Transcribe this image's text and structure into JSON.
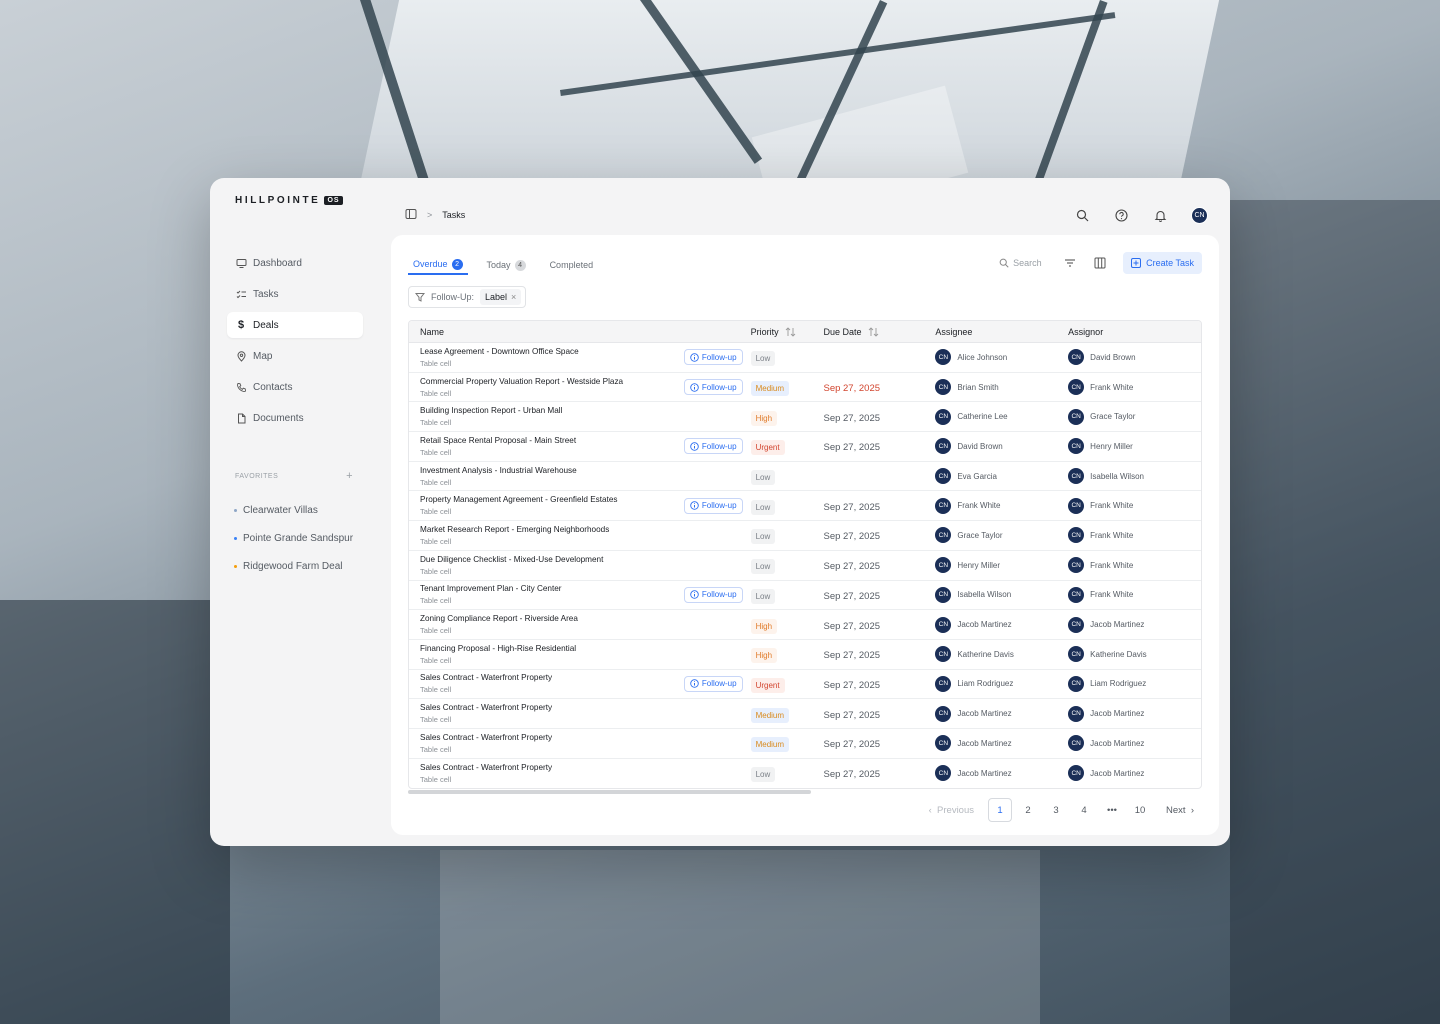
{
  "brand": {
    "name": "HILLPOINTE",
    "suffix": "OS"
  },
  "nav": [
    {
      "label": "Dashboard",
      "icon": "monitor-icon"
    },
    {
      "label": "Tasks",
      "icon": "checklist-icon"
    },
    {
      "label": "Deals",
      "icon": "dollar-icon",
      "active": true
    },
    {
      "label": "Map",
      "icon": "map-pin-icon"
    },
    {
      "label": "Contacts",
      "icon": "phone-icon"
    },
    {
      "label": "Documents",
      "icon": "file-icon"
    }
  ],
  "favorites": {
    "heading": "FAVORITES",
    "add": "+",
    "items": [
      {
        "label": "Clearwater Villas",
        "color": "#8ea6c6"
      },
      {
        "label": "Pointe Grande Sandspur",
        "color": "#3b82f6"
      },
      {
        "label": "Ridgewood Farm Deal",
        "color": "#f59e0b"
      }
    ]
  },
  "breadcrumb": {
    "separator": ">",
    "current": "Tasks"
  },
  "user": {
    "initials": "CN"
  },
  "tabs": [
    {
      "label": "Overdue",
      "count": "2",
      "active": true
    },
    {
      "label": "Today",
      "count": "4"
    },
    {
      "label": "Completed"
    }
  ],
  "search": {
    "placeholder": "Search"
  },
  "create_label": "Create Task",
  "filter": {
    "label": "Follow-Up:",
    "value": "Label",
    "remove": "×"
  },
  "columns": {
    "name": "Name",
    "priority": "Priority",
    "due": "Due Date",
    "assignee": "Assignee",
    "assignor": "Assignor"
  },
  "follow_label": "Follow-up",
  "sub_label": "Table cell",
  "priority_styles": {
    "Low": {
      "bg": "#f1f2f3",
      "fg": "#7b8087"
    },
    "Medium": {
      "bg": "#e7effd",
      "fg": "#d98a1c"
    },
    "High": {
      "bg": "#fdf3ec",
      "fg": "#e07b2a"
    },
    "Urgent": {
      "bg": "#fdeeea",
      "fg": "#d2452f"
    }
  },
  "rows": [
    {
      "name": "Lease Agreement - Downtown Office Space",
      "follow": true,
      "priority": "Low",
      "due": "",
      "assignee": "Alice Johnson",
      "assignor": "David Brown"
    },
    {
      "name": "Commercial Property Valuation Report - Westside Plaza",
      "follow": true,
      "priority": "Medium",
      "due": "Sep 27, 2025",
      "overdue": true,
      "assignee": "Brian Smith",
      "assignor": "Frank White"
    },
    {
      "name": "Building Inspection Report - Urban Mall",
      "follow": false,
      "priority": "High",
      "due": "Sep 27, 2025",
      "assignee": "Catherine Lee",
      "assignor": "Grace Taylor"
    },
    {
      "name": "Retail Space Rental Proposal - Main Street",
      "follow": true,
      "priority": "Urgent",
      "due": "Sep 27, 2025",
      "assignee": "David Brown",
      "assignor": "Henry Miller"
    },
    {
      "name": "Investment Analysis - Industrial Warehouse",
      "follow": false,
      "priority": "Low",
      "due": "",
      "assignee": "Eva Garcia",
      "assignor": "Isabella Wilson"
    },
    {
      "name": "Property Management Agreement - Greenfield Estates",
      "follow": true,
      "priority": "Low",
      "due": "Sep 27, 2025",
      "assignee": "Frank White",
      "assignor": "Frank White"
    },
    {
      "name": "Market Research Report - Emerging Neighborhoods",
      "follow": false,
      "priority": "Low",
      "due": "Sep 27, 2025",
      "assignee": "Grace Taylor",
      "assignor": "Frank White"
    },
    {
      "name": "Due Diligence Checklist - Mixed-Use Development",
      "follow": false,
      "priority": "Low",
      "due": "Sep 27, 2025",
      "assignee": "Henry Miller",
      "assignor": "Frank White"
    },
    {
      "name": "Tenant Improvement Plan - City Center",
      "follow": true,
      "priority": "Low",
      "due": "Sep 27, 2025",
      "assignee": "Isabella Wilson",
      "assignor": "Frank White"
    },
    {
      "name": "Zoning Compliance Report - Riverside Area",
      "follow": false,
      "priority": "High",
      "due": "Sep 27, 2025",
      "assignee": "Jacob Martinez",
      "assignor": "Jacob Martinez"
    },
    {
      "name": "Financing Proposal - High-Rise Residential",
      "follow": false,
      "priority": "High",
      "due": "Sep 27, 2025",
      "assignee": "Katherine Davis",
      "assignor": "Katherine Davis"
    },
    {
      "name": "Sales Contract - Waterfront Property",
      "follow": true,
      "priority": "Urgent",
      "due": "Sep 27, 2025",
      "assignee": "Liam Rodriguez",
      "assignor": "Liam Rodriguez"
    },
    {
      "name": "Sales Contract - Waterfront Property",
      "follow": false,
      "priority": "Medium",
      "due": "Sep 27, 2025",
      "assignee": "Jacob Martinez",
      "assignor": "Jacob Martinez"
    },
    {
      "name": "Sales Contract - Waterfront Property",
      "follow": false,
      "priority": "Medium",
      "due": "Sep 27, 2025",
      "assignee": "Jacob Martinez",
      "assignor": "Jacob Martinez"
    },
    {
      "name": "Sales Contract - Waterfront Property",
      "follow": false,
      "priority": "Low",
      "due": "Sep 27, 2025",
      "assignee": "Jacob Martinez",
      "assignor": "Jacob Martinez"
    }
  ],
  "pagination": {
    "previous": "Previous",
    "next": "Next",
    "pages": [
      "1",
      "2",
      "3",
      "4",
      "•••",
      "10"
    ],
    "current": "1"
  }
}
